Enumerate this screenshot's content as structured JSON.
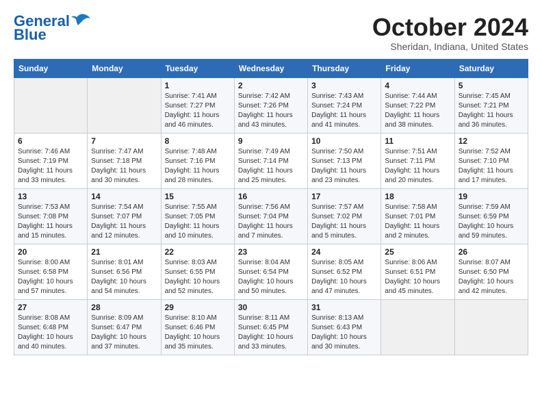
{
  "header": {
    "logo_general": "General",
    "logo_blue": "Blue",
    "month": "October 2024",
    "location": "Sheridan, Indiana, United States"
  },
  "weekdays": [
    "Sunday",
    "Monday",
    "Tuesday",
    "Wednesday",
    "Thursday",
    "Friday",
    "Saturday"
  ],
  "weeks": [
    [
      {
        "day": "",
        "sunrise": "",
        "sunset": "",
        "daylight": ""
      },
      {
        "day": "",
        "sunrise": "",
        "sunset": "",
        "daylight": ""
      },
      {
        "day": "1",
        "sunrise": "Sunrise: 7:41 AM",
        "sunset": "Sunset: 7:27 PM",
        "daylight": "Daylight: 11 hours and 46 minutes."
      },
      {
        "day": "2",
        "sunrise": "Sunrise: 7:42 AM",
        "sunset": "Sunset: 7:26 PM",
        "daylight": "Daylight: 11 hours and 43 minutes."
      },
      {
        "day": "3",
        "sunrise": "Sunrise: 7:43 AM",
        "sunset": "Sunset: 7:24 PM",
        "daylight": "Daylight: 11 hours and 41 minutes."
      },
      {
        "day": "4",
        "sunrise": "Sunrise: 7:44 AM",
        "sunset": "Sunset: 7:22 PM",
        "daylight": "Daylight: 11 hours and 38 minutes."
      },
      {
        "day": "5",
        "sunrise": "Sunrise: 7:45 AM",
        "sunset": "Sunset: 7:21 PM",
        "daylight": "Daylight: 11 hours and 36 minutes."
      }
    ],
    [
      {
        "day": "6",
        "sunrise": "Sunrise: 7:46 AM",
        "sunset": "Sunset: 7:19 PM",
        "daylight": "Daylight: 11 hours and 33 minutes."
      },
      {
        "day": "7",
        "sunrise": "Sunrise: 7:47 AM",
        "sunset": "Sunset: 7:18 PM",
        "daylight": "Daylight: 11 hours and 30 minutes."
      },
      {
        "day": "8",
        "sunrise": "Sunrise: 7:48 AM",
        "sunset": "Sunset: 7:16 PM",
        "daylight": "Daylight: 11 hours and 28 minutes."
      },
      {
        "day": "9",
        "sunrise": "Sunrise: 7:49 AM",
        "sunset": "Sunset: 7:14 PM",
        "daylight": "Daylight: 11 hours and 25 minutes."
      },
      {
        "day": "10",
        "sunrise": "Sunrise: 7:50 AM",
        "sunset": "Sunset: 7:13 PM",
        "daylight": "Daylight: 11 hours and 23 minutes."
      },
      {
        "day": "11",
        "sunrise": "Sunrise: 7:51 AM",
        "sunset": "Sunset: 7:11 PM",
        "daylight": "Daylight: 11 hours and 20 minutes."
      },
      {
        "day": "12",
        "sunrise": "Sunrise: 7:52 AM",
        "sunset": "Sunset: 7:10 PM",
        "daylight": "Daylight: 11 hours and 17 minutes."
      }
    ],
    [
      {
        "day": "13",
        "sunrise": "Sunrise: 7:53 AM",
        "sunset": "Sunset: 7:08 PM",
        "daylight": "Daylight: 11 hours and 15 minutes."
      },
      {
        "day": "14",
        "sunrise": "Sunrise: 7:54 AM",
        "sunset": "Sunset: 7:07 PM",
        "daylight": "Daylight: 11 hours and 12 minutes."
      },
      {
        "day": "15",
        "sunrise": "Sunrise: 7:55 AM",
        "sunset": "Sunset: 7:05 PM",
        "daylight": "Daylight: 11 hours and 10 minutes."
      },
      {
        "day": "16",
        "sunrise": "Sunrise: 7:56 AM",
        "sunset": "Sunset: 7:04 PM",
        "daylight": "Daylight: 11 hours and 7 minutes."
      },
      {
        "day": "17",
        "sunrise": "Sunrise: 7:57 AM",
        "sunset": "Sunset: 7:02 PM",
        "daylight": "Daylight: 11 hours and 5 minutes."
      },
      {
        "day": "18",
        "sunrise": "Sunrise: 7:58 AM",
        "sunset": "Sunset: 7:01 PM",
        "daylight": "Daylight: 11 hours and 2 minutes."
      },
      {
        "day": "19",
        "sunrise": "Sunrise: 7:59 AM",
        "sunset": "Sunset: 6:59 PM",
        "daylight": "Daylight: 10 hours and 59 minutes."
      }
    ],
    [
      {
        "day": "20",
        "sunrise": "Sunrise: 8:00 AM",
        "sunset": "Sunset: 6:58 PM",
        "daylight": "Daylight: 10 hours and 57 minutes."
      },
      {
        "day": "21",
        "sunrise": "Sunrise: 8:01 AM",
        "sunset": "Sunset: 6:56 PM",
        "daylight": "Daylight: 10 hours and 54 minutes."
      },
      {
        "day": "22",
        "sunrise": "Sunrise: 8:03 AM",
        "sunset": "Sunset: 6:55 PM",
        "daylight": "Daylight: 10 hours and 52 minutes."
      },
      {
        "day": "23",
        "sunrise": "Sunrise: 8:04 AM",
        "sunset": "Sunset: 6:54 PM",
        "daylight": "Daylight: 10 hours and 50 minutes."
      },
      {
        "day": "24",
        "sunrise": "Sunrise: 8:05 AM",
        "sunset": "Sunset: 6:52 PM",
        "daylight": "Daylight: 10 hours and 47 minutes."
      },
      {
        "day": "25",
        "sunrise": "Sunrise: 8:06 AM",
        "sunset": "Sunset: 6:51 PM",
        "daylight": "Daylight: 10 hours and 45 minutes."
      },
      {
        "day": "26",
        "sunrise": "Sunrise: 8:07 AM",
        "sunset": "Sunset: 6:50 PM",
        "daylight": "Daylight: 10 hours and 42 minutes."
      }
    ],
    [
      {
        "day": "27",
        "sunrise": "Sunrise: 8:08 AM",
        "sunset": "Sunset: 6:48 PM",
        "daylight": "Daylight: 10 hours and 40 minutes."
      },
      {
        "day": "28",
        "sunrise": "Sunrise: 8:09 AM",
        "sunset": "Sunset: 6:47 PM",
        "daylight": "Daylight: 10 hours and 37 minutes."
      },
      {
        "day": "29",
        "sunrise": "Sunrise: 8:10 AM",
        "sunset": "Sunset: 6:46 PM",
        "daylight": "Daylight: 10 hours and 35 minutes."
      },
      {
        "day": "30",
        "sunrise": "Sunrise: 8:11 AM",
        "sunset": "Sunset: 6:45 PM",
        "daylight": "Daylight: 10 hours and 33 minutes."
      },
      {
        "day": "31",
        "sunrise": "Sunrise: 8:13 AM",
        "sunset": "Sunset: 6:43 PM",
        "daylight": "Daylight: 10 hours and 30 minutes."
      },
      {
        "day": "",
        "sunrise": "",
        "sunset": "",
        "daylight": ""
      },
      {
        "day": "",
        "sunrise": "",
        "sunset": "",
        "daylight": ""
      }
    ]
  ]
}
